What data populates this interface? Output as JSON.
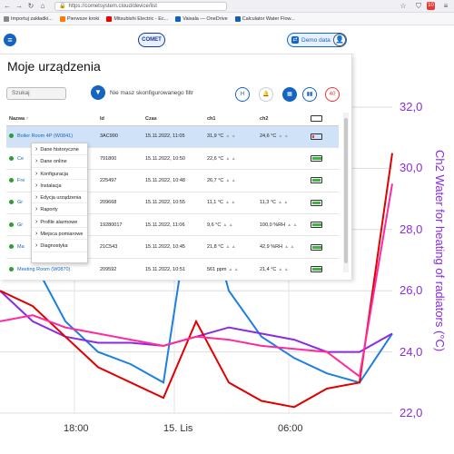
{
  "browser": {
    "url": "https://cometsystem.cloud/device/list",
    "badge": "10"
  },
  "bookmarks": [
    "Importuj zakładki...",
    "Pierwsze kroki",
    "Mitsubishi Electric - Ec...",
    "Vaisala — OneDrive",
    "Calculator Water Flow..."
  ],
  "header": {
    "logo": "COMET",
    "demo_label": "Demo data"
  },
  "page": {
    "title": "Moje urządzenia",
    "search_placeholder": "Szukaj",
    "no_filter": "Nie masz skonfigurowanego filtr"
  },
  "toolbar": {
    "btn_hex": "H",
    "btn_bell": "🔔",
    "btn_grid": "▦",
    "btn_bars": "▮▮",
    "btn_count": "40"
  },
  "table": {
    "headers": [
      "Nazwa ↑",
      "Id",
      "Czas",
      "ch1",
      "ch2"
    ],
    "rows": [
      {
        "name": "Boiler Room 4P (W0841)",
        "id": "3AC990",
        "time": "15.11.2022, 11:05",
        "ch1": "31,9 °C",
        "ch2": "24,6 °C",
        "battery": 0.2
      },
      {
        "name": "Ce",
        "id": "791800",
        "time": "15.11.2022, 10:50",
        "ch1": "22,6 °C",
        "ch2": "",
        "battery": 1.0
      },
      {
        "name": "Fre",
        "id": "225497",
        "time": "15.11.2022, 10:48",
        "ch1": "26,7 °C",
        "ch2": "",
        "battery": 0.85
      },
      {
        "name": "Gr",
        "id": "209668",
        "time": "15.11.2022, 10:55",
        "ch1": "11,1 °C",
        "ch2": "11,3 °C",
        "battery": 0.85
      },
      {
        "name": "Gr",
        "id": "19280017",
        "time": "15.11.2022, 11:06",
        "ch1": "9,6 °C",
        "ch2": "100,0 %RH",
        "battery": 1.0
      },
      {
        "name": "Ma",
        "id": "21C543",
        "time": "15.11.2022, 10:45",
        "ch1": "21,8 °C",
        "ch2": "42,9 %RH",
        "battery": 1.0
      },
      {
        "name": "Meeting Room (W0870)",
        "id": "209592",
        "time": "15.11.2022, 10:51",
        "ch1": "561 ppm",
        "ch2": "21,4 °C",
        "battery": 1.0
      }
    ]
  },
  "context_menu": [
    "Dane historyczne",
    "Dane online",
    "Konfiguracja",
    "Instalacja",
    "Edycja urządzenia",
    "Raporty",
    "Profile alarmowe",
    "Miejsca pomiarowe",
    "Diagnostyka"
  ],
  "chart_data": {
    "type": "line",
    "ylabel": "Ch2 Water for heating of radiators (°C)",
    "y_ticks": [
      "32,0",
      "30,0",
      "28,0",
      "26,0",
      "24,0",
      "22,0"
    ],
    "ylim": [
      22,
      32
    ],
    "x_ticks": [
      "18:00",
      "15. Lis",
      "06:00"
    ],
    "series": [
      {
        "color": "#1e7fe0",
        "values": [
          30,
          27,
          25,
          24,
          23.6,
          23,
          30,
          26,
          24.5,
          23.8,
          23.3,
          23,
          24.6
        ]
      },
      {
        "color": "#8a2be2",
        "values": [
          26,
          25,
          24.5,
          24.3,
          24.3,
          24.2,
          24.5,
          24.8,
          24.6,
          24.4,
          24,
          24,
          24.6
        ]
      },
      {
        "color": "#e00000",
        "values": [
          26,
          25.5,
          24.5,
          23.5,
          23,
          22.5,
          25,
          23,
          22.4,
          22.2,
          22.8,
          23,
          30.5
        ]
      },
      {
        "color": "#ff2aa0",
        "values": [
          25,
          25.2,
          24.8,
          24.6,
          24.4,
          24.2,
          24.5,
          24.4,
          24.2,
          24.1,
          24,
          23.2,
          29.5
        ]
      }
    ]
  }
}
